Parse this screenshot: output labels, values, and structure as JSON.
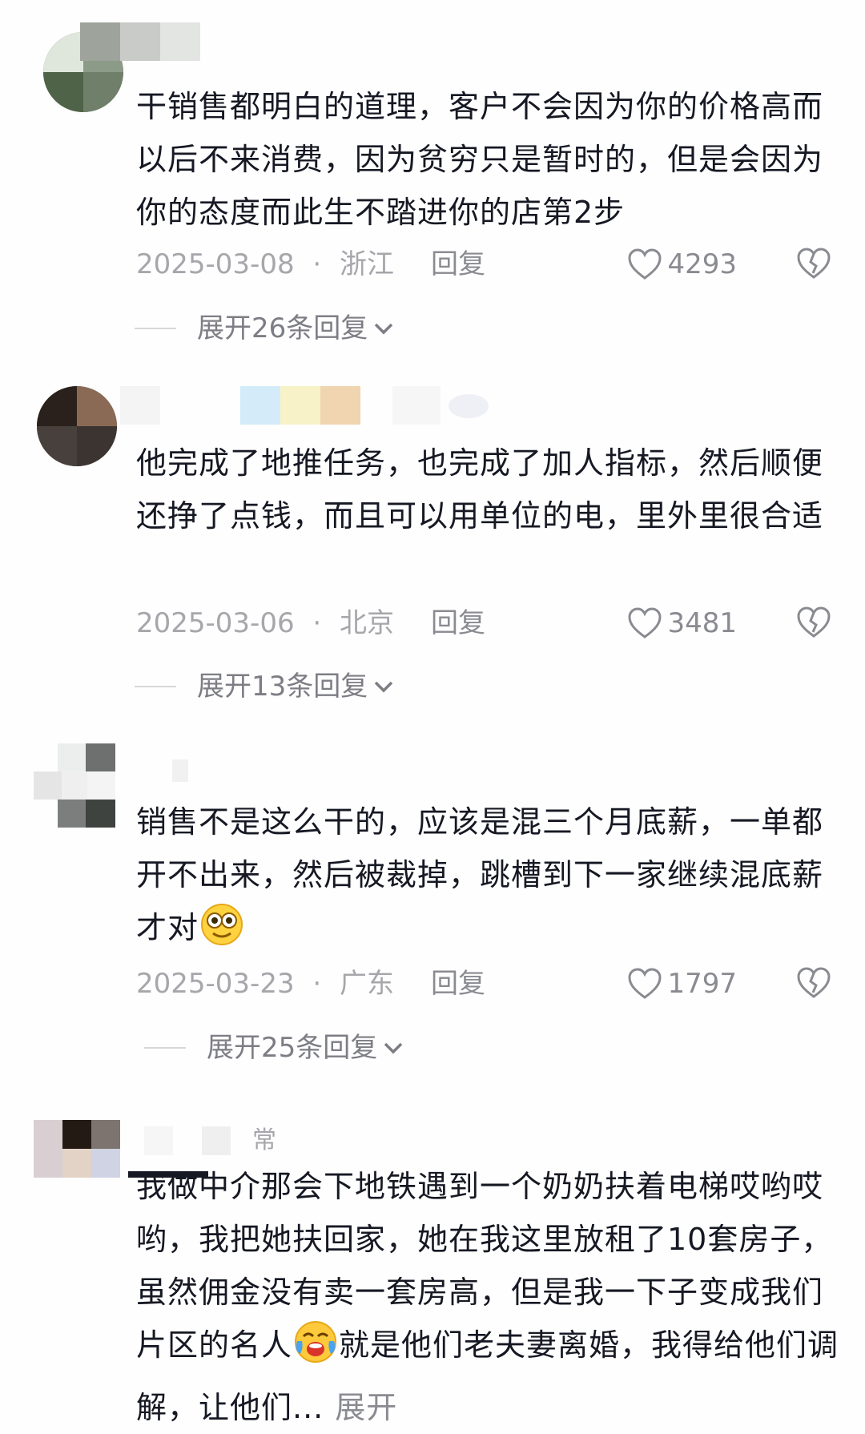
{
  "comments": [
    {
      "text": "干销售都明白的道理，客户不会因为你的价格高而以后不来消费，因为贫穷只是暂时的，但是会因为你的态度而此生不踏进你的店第2步",
      "date": "2025-03-08",
      "location": "浙江",
      "reply_label": "回复",
      "likes": "4293",
      "expand_label": "展开26条回复"
    },
    {
      "text": "他完成了地推任务，也完成了加人指标，然后顺便还挣了点钱，而且可以用单位的电，里外里很合适",
      "date": "2025-03-06",
      "location": "北京",
      "reply_label": "回复",
      "likes": "3481",
      "expand_label": "展开13条回复"
    },
    {
      "text": "销售不是这么干的，应该是混三个月底薪，一单都开不出来，然后被裁掉，跳槽到下一家继续混底薪才对",
      "date": "2025-03-23",
      "location": "广东",
      "reply_label": "回复",
      "likes": "1797",
      "expand_label": "展开25条回复"
    },
    {
      "username_fragment": "常",
      "text_before_emoji": "我做中介那会下地铁遇到一个奶奶扶着电梯哎哟哎哟，我把她扶回家，她在我这里放租了10套房子，虽然佣金没有卖一套房高，但是我一下子变成我们片区的名人",
      "text_after_emoji": "就是他们老夫妻离婚，我得给他们调解，让他们...",
      "more_label": "展开"
    }
  ],
  "separator": "·",
  "colors": {
    "text": "#161823",
    "meta": "#a6a6ab",
    "secondary": "#8a8b91"
  }
}
